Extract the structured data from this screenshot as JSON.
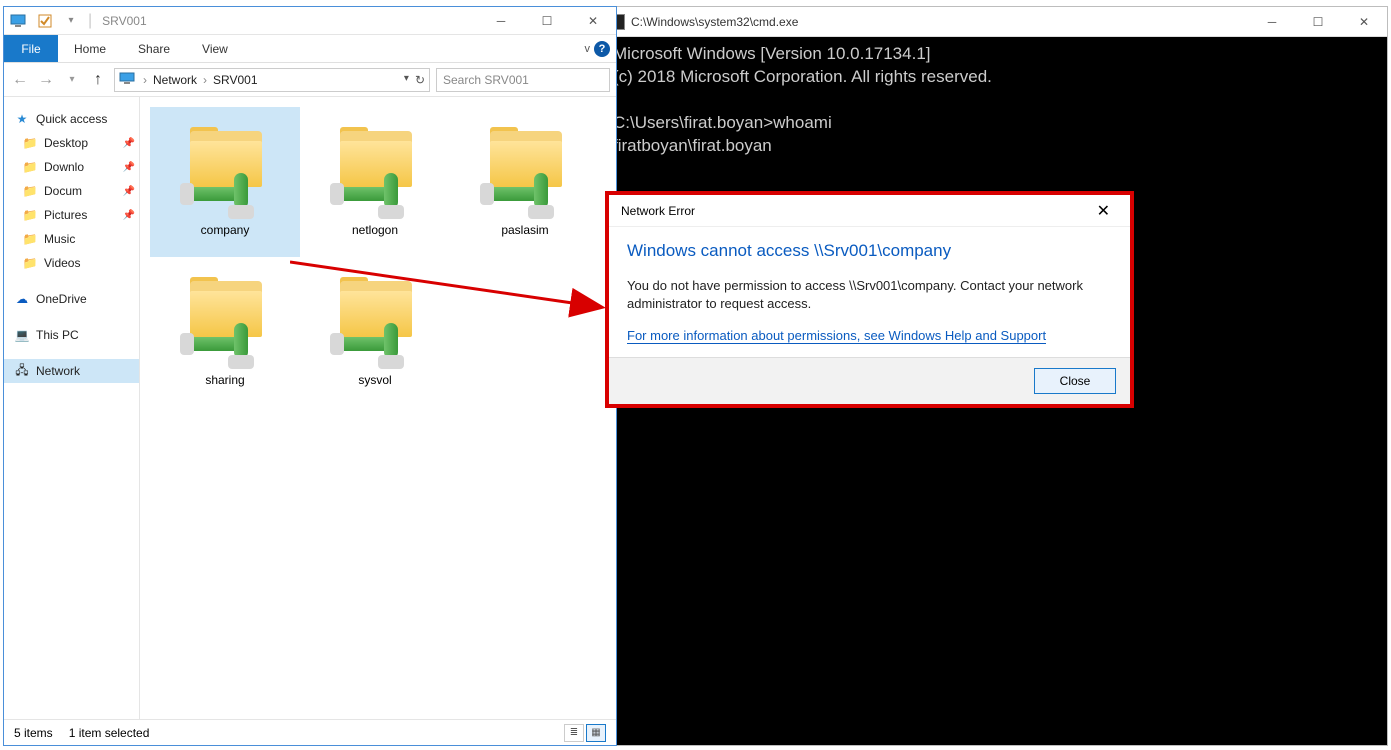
{
  "explorer": {
    "title": "SRV001",
    "ribbon": {
      "file": "File",
      "tabs": [
        "Home",
        "Share",
        "View"
      ]
    },
    "breadcrumb": [
      "Network",
      "SRV001"
    ],
    "search_placeholder": "Search SRV001",
    "sidebar": {
      "quick_access": "Quick access",
      "items": [
        {
          "label": "Desktop",
          "pinned": true
        },
        {
          "label": "Downlo",
          "pinned": true
        },
        {
          "label": "Docum",
          "pinned": true
        },
        {
          "label": "Pictures",
          "pinned": true
        },
        {
          "label": "Music",
          "pinned": false
        },
        {
          "label": "Videos",
          "pinned": false
        }
      ],
      "onedrive": "OneDrive",
      "thispc": "This PC",
      "network": "Network"
    },
    "files": [
      {
        "label": "company",
        "selected": true
      },
      {
        "label": "netlogon",
        "selected": false
      },
      {
        "label": "paslasim",
        "selected": false
      },
      {
        "label": "sharing",
        "selected": false
      },
      {
        "label": "sysvol",
        "selected": false
      }
    ],
    "status": {
      "count": "5 items",
      "selection": "1 item selected"
    }
  },
  "cmd": {
    "title": "C:\\Windows\\system32\\cmd.exe",
    "lines": [
      "Microsoft Windows [Version 10.0.17134.1]",
      "(c) 2018 Microsoft Corporation. All rights reserved.",
      "",
      "C:\\Users\\firat.boyan>whoami",
      "firatboyan\\firat.boyan"
    ]
  },
  "dialog": {
    "title": "Network Error",
    "heading": "Windows cannot access \\\\Srv001\\company",
    "message": "You do not have permission to access \\\\Srv001\\company. Contact your network administrator to request access.",
    "link": "For more information about permissions, see Windows Help and Support",
    "close": "Close"
  }
}
